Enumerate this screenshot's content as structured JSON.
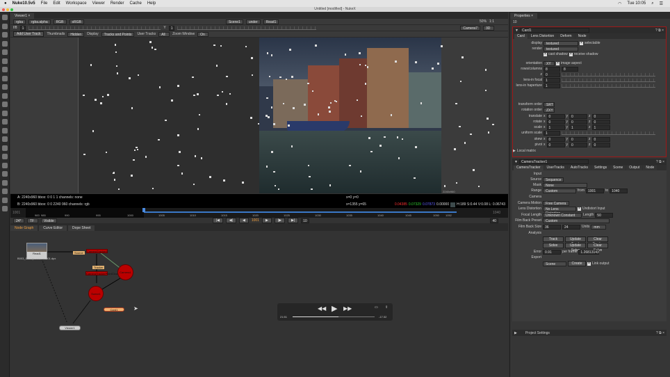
{
  "menubar": {
    "app": "Nuke10.5v5",
    "items": [
      "File",
      "Edit",
      "Workspace",
      "Viewer",
      "Render",
      "Cache",
      "Help"
    ],
    "clock": "Tue 10:05"
  },
  "window": {
    "title": "Untitled [modified] - NukeX"
  },
  "viewer": {
    "tab": "Viewer1",
    "row1": {
      "channels": "rgba",
      "alpha": "rgba.alpha",
      "display": "RGB",
      "lut": "sRGB",
      "input_a": "Scene1",
      "op": "under",
      "input_b": "Read1",
      "zoom": "50%",
      "ratio": "1:1"
    },
    "row2": {
      "fstop": "f/8",
      "gain": "1",
      "gamma_label": "Y",
      "gamma": "1",
      "camera": "Camera7",
      "mode": "3D"
    },
    "row3": {
      "add_user_track": "Add User Track",
      "thumbnails_label": "Thumbnails",
      "thumbnails": "Hidden",
      "display_label": "Display",
      "display": "Tracks and Points",
      "user_tracks_label": "User Tracks",
      "user_tracks": "All",
      "zoom_window_label": "Zoom Window",
      "zoom_window": "On"
    },
    "format_label": "2240x960",
    "info_a": "A:   2240x960  bbox: 0 0 1 1 channels: none",
    "info_b": "B:   2240x960  bbox: 0 0 2240 960 channels: rgb",
    "coord_a": "x=0 y=0",
    "coord_b": "x=1355 y=65",
    "pixel": {
      "r": "0.04385",
      "g": "0.07329",
      "b": "0.07873",
      "a": "0.00000",
      "hsv": "H:189 S:0.44 V:0.08  L: 0.06743"
    },
    "colors": {
      "r": "#ff3030",
      "g": "#30d030",
      "b": "#5050ff"
    }
  },
  "timeline": {
    "start": "1001",
    "end": "1040",
    "ticks": [
      "983",
      "985",
      "990",
      "995",
      "1000",
      "1005",
      "1010",
      "1015",
      "1020",
      "1025",
      "1030",
      "1035",
      "1040",
      "1045",
      "1050",
      "1052"
    ],
    "current": "1001",
    "fps": "24*",
    "tf": "TF",
    "visible": "Visible",
    "step": "10",
    "end_field": "40"
  },
  "bottom_tabs": [
    "Node Graph",
    "Curve Editor",
    "Dope Sheet"
  ],
  "nodes": {
    "read": "Read1",
    "read_file": "B003_C008_0214CE.1001.dpx",
    "camtracker": "CameraTracker1",
    "source": "Source",
    "tracker": "Tracker",
    "pointcloud": "CameraTrackerPointCloud1",
    "camera": "Camera1",
    "scene": "Scene1",
    "card": "Card1",
    "viewer": "Viewer1"
  },
  "player": {
    "elapsed": "21:51",
    "remaining": "-17:32",
    "progress": 0.56
  },
  "properties": {
    "title": "Properties",
    "count": "10",
    "card": {
      "name": "Card1",
      "tabs": [
        "Card",
        "Lens Distortion",
        "Deform",
        "Node"
      ],
      "display_label": "display",
      "display": "textured",
      "selectable": "selectable",
      "render_label": "render",
      "render": "textured",
      "cast_shadow": "cast shadow",
      "receive_shadow": "receive shadow",
      "orientation_label": "orientation",
      "orientation": "XY",
      "image_aspect": "image aspect",
      "rows_label": "rows/columns",
      "rows": "8",
      "cols": "8",
      "z_label": "z",
      "z": "0",
      "focal_label": "lens-in focal",
      "focal": "1",
      "haperture_label": "lens-in haperture",
      "haperture": "1",
      "transform_order_label": "transform order",
      "transform_order": "SRT",
      "rotation_order_label": "rotation order",
      "rotation_order": "ZXY",
      "xyz": [
        {
          "label": "translate",
          "x": "0",
          "y": "0",
          "z": "0"
        },
        {
          "label": "rotate",
          "x": "0",
          "y": "0",
          "z": "0"
        },
        {
          "label": "scale",
          "x": "1",
          "y": "1",
          "z": "1"
        }
      ],
      "uniform_label": "uniform scale",
      "uniform": "1",
      "xyz2": [
        {
          "label": "skew",
          "x": "0",
          "y": "0",
          "z": "0"
        },
        {
          "label": "pivot",
          "x": "0",
          "y": "0",
          "z": "0"
        }
      ],
      "local_matrix": "Local matrix"
    },
    "tracker": {
      "name": "CameraTracker1",
      "tabs": [
        "CameraTracker",
        "UserTracks",
        "AutoTracks",
        "Settings",
        "Scene",
        "Output",
        "Node"
      ],
      "input": "Input",
      "source_label": "Source",
      "source": "Sequence",
      "mask_label": "Mask",
      "mask": "None",
      "range_label": "Range",
      "range": "Custom",
      "from_label": "from",
      "from": "1001",
      "to_label": "to",
      "to": "1040",
      "camera": "Camera",
      "motion_label": "Camera Motion",
      "motion": "Free Camera",
      "lens_label": "Lens Distortion",
      "lens": "No Lens Distortion",
      "undistort": "Undistort Input",
      "focal_label": "Focal Length",
      "focal": "Unknown Constant",
      "length_label": "Length",
      "length": "50",
      "preset_label": "Film Back Preset",
      "preset": "Custom",
      "size_label": "Film Back Size",
      "size_x": "36",
      "size_y": "24",
      "units_label": "Units",
      "units": "mm",
      "analysis": "Analysis",
      "track": "Track",
      "update_track": "Update Track",
      "clear_tracks": "Clear Tracks",
      "solve": "Solve",
      "update_solve": "Update Solve",
      "clear_solve": "Clear Solve",
      "error_label": "Error",
      "error": "0.91",
      "per_frame_label": "per frame",
      "per_frame": "1.26813143",
      "export": "Export",
      "export_type": "Scene",
      "create": "Create",
      "link_output": "Link output"
    },
    "project_settings": "Project Settings"
  },
  "accent": "#f0a040",
  "selection_border": "#a01818"
}
